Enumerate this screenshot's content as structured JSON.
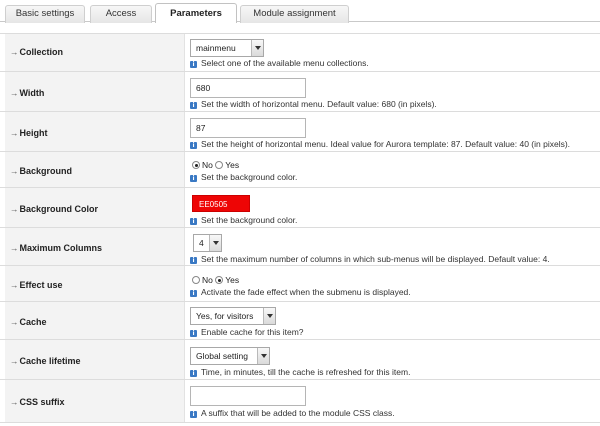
{
  "tabs": [
    {
      "label": "Basic settings",
      "active": false
    },
    {
      "label": "Access",
      "active": false
    },
    {
      "label": "Parameters",
      "active": true
    },
    {
      "label": "Module assignment",
      "active": false
    }
  ],
  "params": {
    "collection": {
      "label": "Collection",
      "value": "mainmenu",
      "hint": "Select one of the available menu collections."
    },
    "width": {
      "label": "Width",
      "value": "680",
      "hint": "Set the width of horizontal menu. Default value: 680 (in pixels)."
    },
    "height": {
      "label": "Height",
      "value": "87",
      "hint": "Set the height of horizontal menu. Ideal value for Aurora template: 87. Default value: 40 (in pixels)."
    },
    "background": {
      "label": "Background",
      "options": [
        "No",
        "Yes"
      ],
      "selected": "No",
      "hint": "Set the background color."
    },
    "background_color": {
      "label": "Background Color",
      "value": "EE0505",
      "hint": "Set the background color."
    },
    "max_columns": {
      "label": "Maximum Columns",
      "value": "4",
      "hint": "Set the maximum number of columns in which sub-menus will be displayed. Default value: 4."
    },
    "effect_use": {
      "label": "Effect use",
      "options": [
        "No",
        "Yes"
      ],
      "selected": "Yes",
      "hint": "Activate the fade effect when the submenu is displayed."
    },
    "cache": {
      "label": "Cache",
      "value": "Yes, for visitors",
      "hint": "Enable cache for this item?"
    },
    "cache_lifetime": {
      "label": "Cache lifetime",
      "value": "Global setting",
      "hint": "Time, in minutes, till the cache is refreshed for this item."
    },
    "css_suffix": {
      "label": "CSS suffix",
      "value": "",
      "hint": "A suffix that will be added to the module CSS class."
    }
  },
  "icons": {
    "arrow": "right-arrow-icon",
    "info": "info-icon",
    "dropdown": "chevron-down-icon"
  },
  "colors": {
    "background_color_swatch": "#EE0505",
    "info_icon": "#3A79C4"
  }
}
